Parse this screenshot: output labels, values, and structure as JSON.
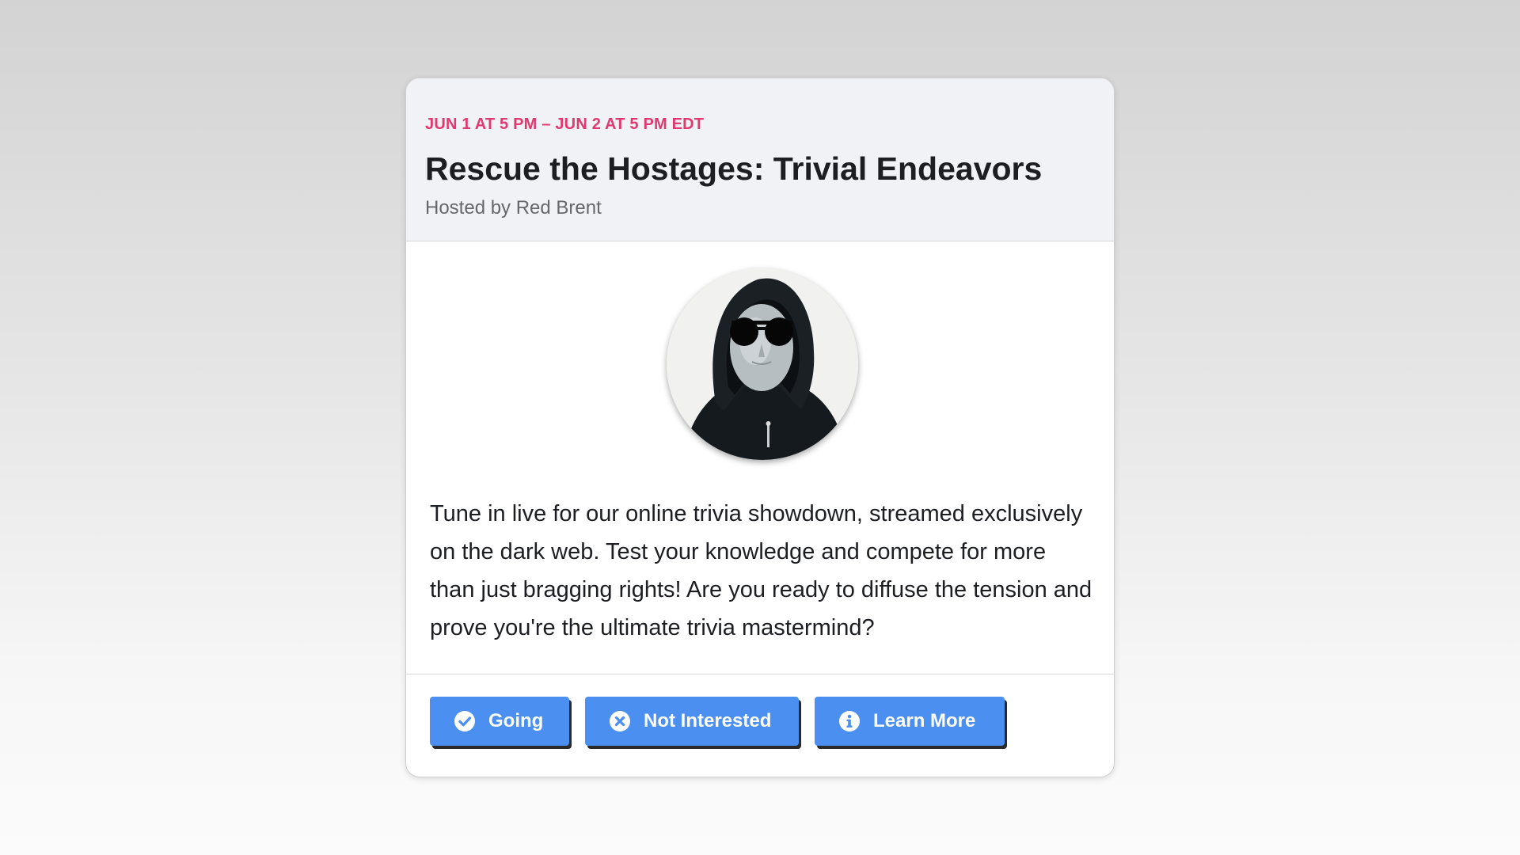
{
  "event": {
    "date_range": "JUN 1 AT 5 PM – JUN 2 AT 5 PM EDT",
    "title": "Rescue the Hostages: Trivial Endeavors",
    "host_line": "Hosted by Red Brent",
    "description": "Tune in live for our online trivia showdown, streamed exclusively on the dark web. Test your knowledge and compete for more than just bragging rights! Are you ready to diffuse the tension and prove you're the ultimate trivia mastermind?"
  },
  "actions": [
    {
      "label": "Going",
      "icon": "check-circle-icon"
    },
    {
      "label": "Not Interested",
      "icon": "x-circle-icon"
    },
    {
      "label": "Learn More",
      "icon": "info-circle-icon"
    }
  ],
  "colors": {
    "date_accent": "#e0396f",
    "button_bg": "#4b8ff0",
    "header_bg": "#f0f2f5"
  }
}
